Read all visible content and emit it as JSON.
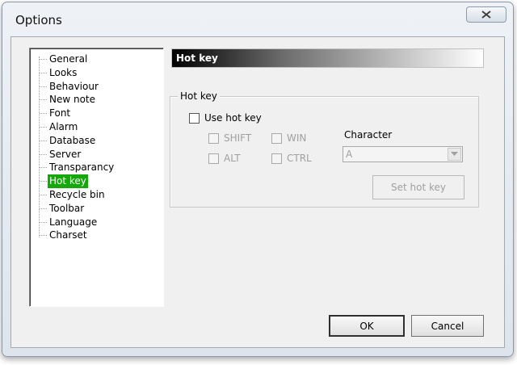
{
  "window": {
    "title": "Options"
  },
  "tree": {
    "items": [
      {
        "label": "General"
      },
      {
        "label": "Looks"
      },
      {
        "label": "Behaviour"
      },
      {
        "label": "New note"
      },
      {
        "label": "Font"
      },
      {
        "label": "Alarm"
      },
      {
        "label": "Database"
      },
      {
        "label": "Server"
      },
      {
        "label": "Transparancy"
      },
      {
        "label": "Hot key",
        "selected": true
      },
      {
        "label": "Recycle bin"
      },
      {
        "label": "Toolbar"
      },
      {
        "label": "Language"
      },
      {
        "label": "Charset"
      }
    ]
  },
  "panel": {
    "header": "Hot key",
    "group_title": "Hot key",
    "use_hot_key": {
      "label": "Use hot key",
      "checked": false
    },
    "shift": {
      "label": "SHIFT",
      "checked": false,
      "disabled": true
    },
    "win": {
      "label": "WIN",
      "checked": false,
      "disabled": true
    },
    "alt": {
      "label": "ALT",
      "checked": false,
      "disabled": true
    },
    "ctrl": {
      "label": "CTRL",
      "checked": false,
      "disabled": true
    },
    "character_label": "Character",
    "character_value": "A",
    "set_hot_key_label": "Set hot key"
  },
  "buttons": {
    "ok": "OK",
    "cancel": "Cancel"
  },
  "colors": {
    "selection": "#14a80a",
    "disabled_text": "#a0a0a0"
  },
  "icons": {
    "close": "close-icon",
    "dropdown": "chevron-down-icon"
  }
}
